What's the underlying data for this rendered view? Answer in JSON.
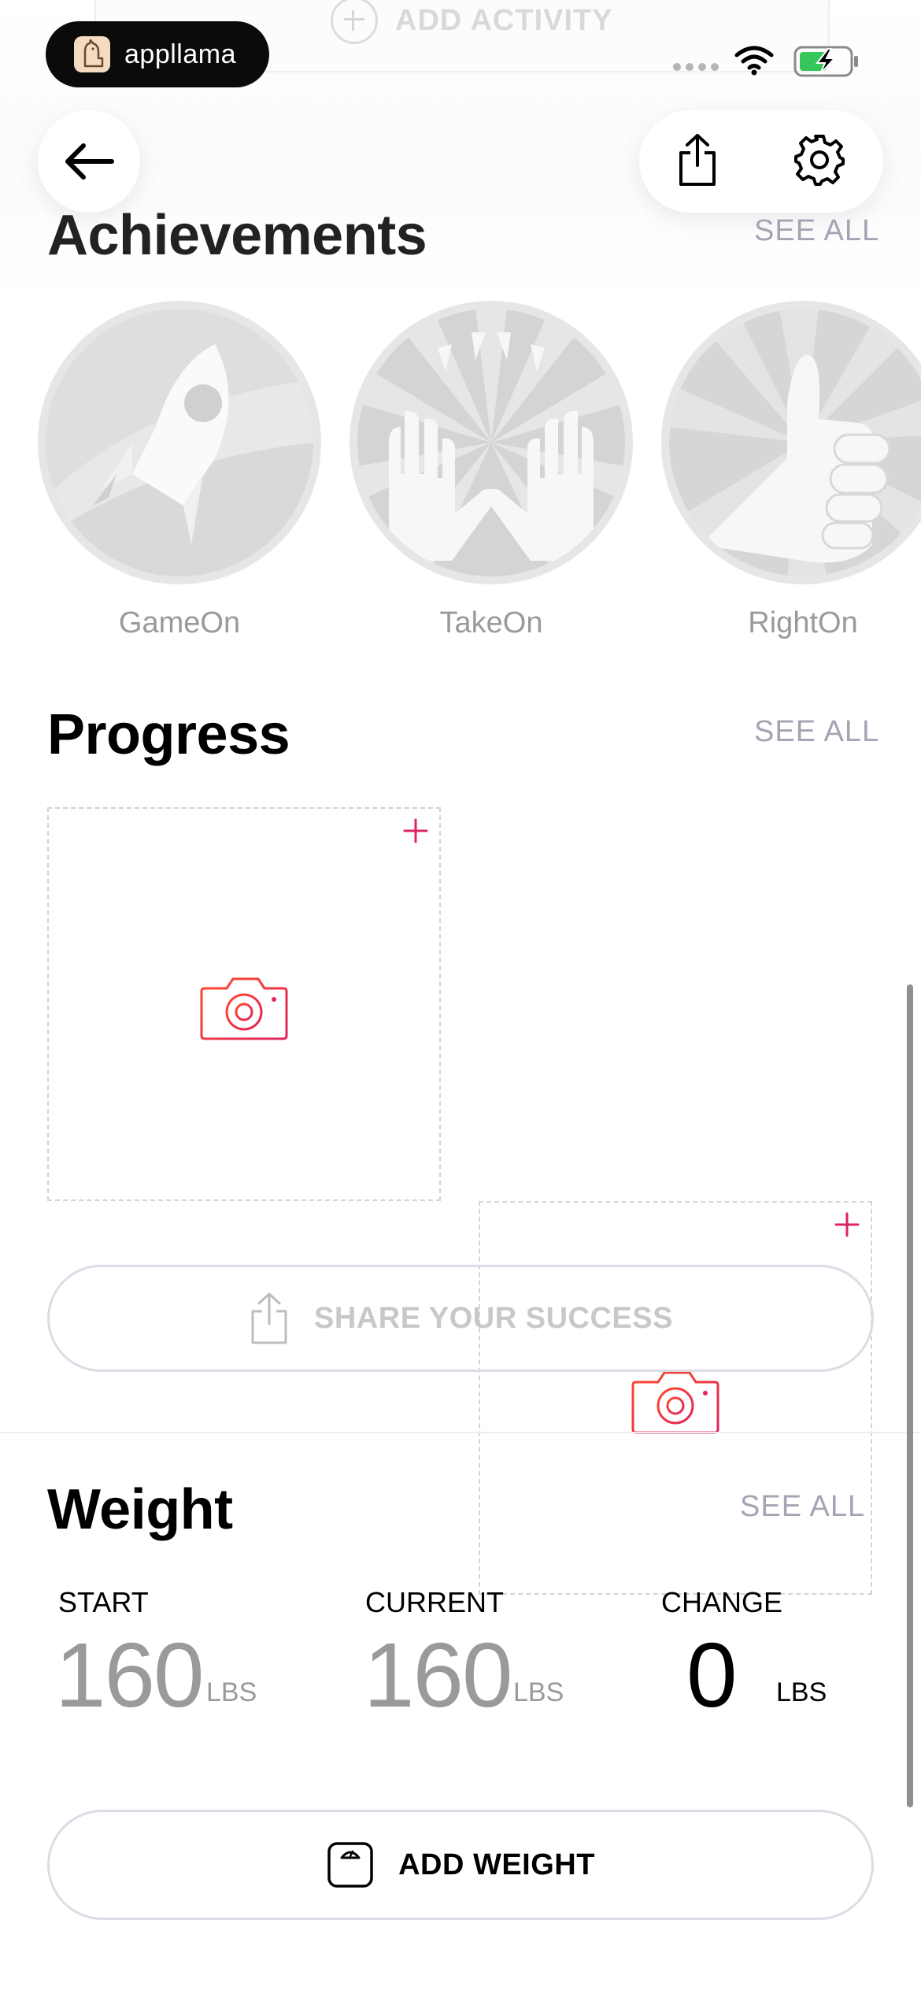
{
  "header": {
    "add_activity_label": "ADD ACTIVITY",
    "appllama_label": "appllama"
  },
  "achievements": {
    "title": "Achievements",
    "see_all": "SEE ALL",
    "badges": [
      {
        "label": "GameOn",
        "icon": "rocket-icon"
      },
      {
        "label": "TakeOn",
        "icon": "raised-hands-icon"
      },
      {
        "label": "RightOn",
        "icon": "thumbs-up-icon"
      }
    ]
  },
  "progress": {
    "title": "Progress",
    "see_all": "SEE ALL",
    "share_button": "SHARE YOUR SUCCESS"
  },
  "weight": {
    "title": "Weight",
    "see_all": "SEE ALL",
    "start_label": "START",
    "start_value": "160",
    "start_unit": "LBS",
    "current_label": "CURRENT",
    "current_value": "160",
    "current_unit": "LBS",
    "change_label": "CHANGE",
    "change_value": "0",
    "change_unit": "LBS",
    "add_button": "ADD WEIGHT"
  },
  "colors": {
    "accent_pink": "#e0245e",
    "camera_gradient_start": "#ff3b30",
    "camera_gradient_end": "#e0245e",
    "see_all": "#a4a4b4"
  }
}
